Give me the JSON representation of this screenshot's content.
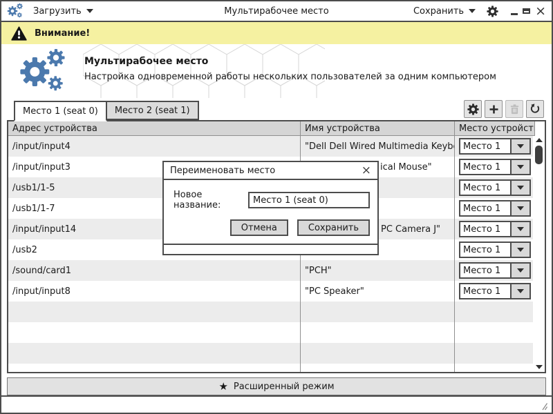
{
  "titlebar": {
    "title": "Мультирабочее место",
    "load_label": "Загрузить",
    "save_label": "Сохранить"
  },
  "warning": {
    "text": "Внимание!"
  },
  "header": {
    "title": "Мультирабочее место",
    "subtitle": "Настройка одновременной работы нескольких пользователей за одним компьютером"
  },
  "tabs": [
    {
      "label": "Место 1 (seat 0)",
      "active": true
    },
    {
      "label": "Место 2 (seat 1)",
      "active": false
    }
  ],
  "toolbar": {
    "buttons": [
      "settings-gear",
      "add-plus",
      "delete-trash (disabled)",
      "undo-reset"
    ]
  },
  "table": {
    "columns": [
      "Адрес устройства",
      "Имя устройства",
      "Место устройства"
    ],
    "rows": [
      {
        "address": "/input/input4",
        "name": "\"Dell Dell Wired Multimedia Keyboard\"",
        "seat": "Место 1"
      },
      {
        "address": "/input/input3",
        "name": "ical Mouse\"",
        "seat": "Место 1"
      },
      {
        "address": "/usb1/1-5",
        "name": "",
        "seat": "Место 1"
      },
      {
        "address": "/usb1/1-7",
        "name": "",
        "seat": "Место 1"
      },
      {
        "address": "/input/input14",
        "name": "PC Camera J\"",
        "seat": "Место 1"
      },
      {
        "address": "/usb2",
        "name": "",
        "seat": "Место 1"
      },
      {
        "address": "/sound/card1",
        "name": "\"PCH\"",
        "seat": "Место 1"
      },
      {
        "address": "/input/input8",
        "name": "\"PC Speaker\"",
        "seat": "Место 1"
      }
    ]
  },
  "dialog": {
    "title": "Переименовать место",
    "label": "Новое название:",
    "input_value": "Место 1 (seat 0)",
    "cancel_label": "Отмена",
    "save_label": "Сохранить"
  },
  "advanced_button": {
    "label": "Расширенный режим"
  },
  "icons": {
    "app_logo": "three-gears",
    "close_glyph": "×",
    "star_glyph": "★",
    "warning": "warning-triangle",
    "select_caret": "chevron-down"
  },
  "colors": {
    "accent_blue": "#4b79ad",
    "warning_bg": "#f5f1a1",
    "border_dark": "#4c4c4c",
    "row_stripe": "#ececec",
    "table_header_bg": "#d5d5d5",
    "control_bg": "#e4e4e4"
  }
}
